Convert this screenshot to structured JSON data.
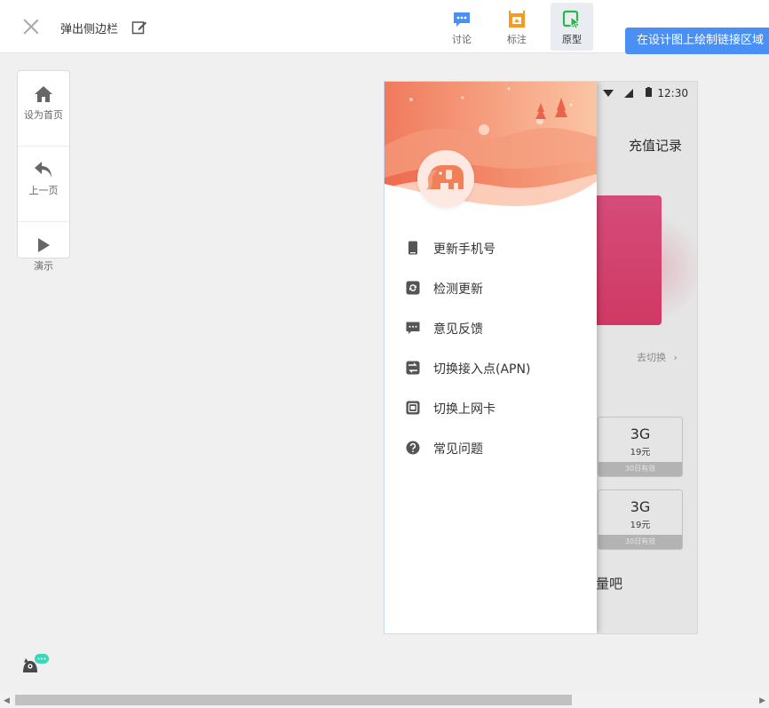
{
  "header": {
    "title": "弹出侧边栏",
    "tools": [
      {
        "label": "讨论"
      },
      {
        "label": "标注"
      },
      {
        "label": "原型"
      }
    ],
    "draw_link_button": "在设计图上绘制链接区域"
  },
  "nav": {
    "items": [
      {
        "label": "设为首页"
      },
      {
        "label": "上一页"
      },
      {
        "label": "演示"
      }
    ]
  },
  "phone": {
    "status_time": "12:30",
    "background": {
      "title": "充值记录",
      "switch_link": "去切换",
      "plans": [
        {
          "size": "3G",
          "price": "19元",
          "valid": "30日有效"
        },
        {
          "size": "3G",
          "price": "19元",
          "valid": "30日有效"
        }
      ],
      "bottom_text": "量吧"
    },
    "drawer": {
      "menu": [
        {
          "label": "更新手机号",
          "icon": "phone-icon"
        },
        {
          "label": "检测更新",
          "icon": "refresh-icon"
        },
        {
          "label": "意见反馈",
          "icon": "feedback-icon"
        },
        {
          "label": "切换接入点(APN)",
          "icon": "swap-icon"
        },
        {
          "label": "切换上网卡",
          "icon": "sim-card-icon"
        },
        {
          "label": "常见问题",
          "icon": "question-icon"
        }
      ]
    }
  },
  "colors": {
    "accent_blue": "#4a90f4",
    "header_coral": "#f07a5c",
    "pink_card": "#ec4c7d",
    "icon_gray": "#555555"
  }
}
